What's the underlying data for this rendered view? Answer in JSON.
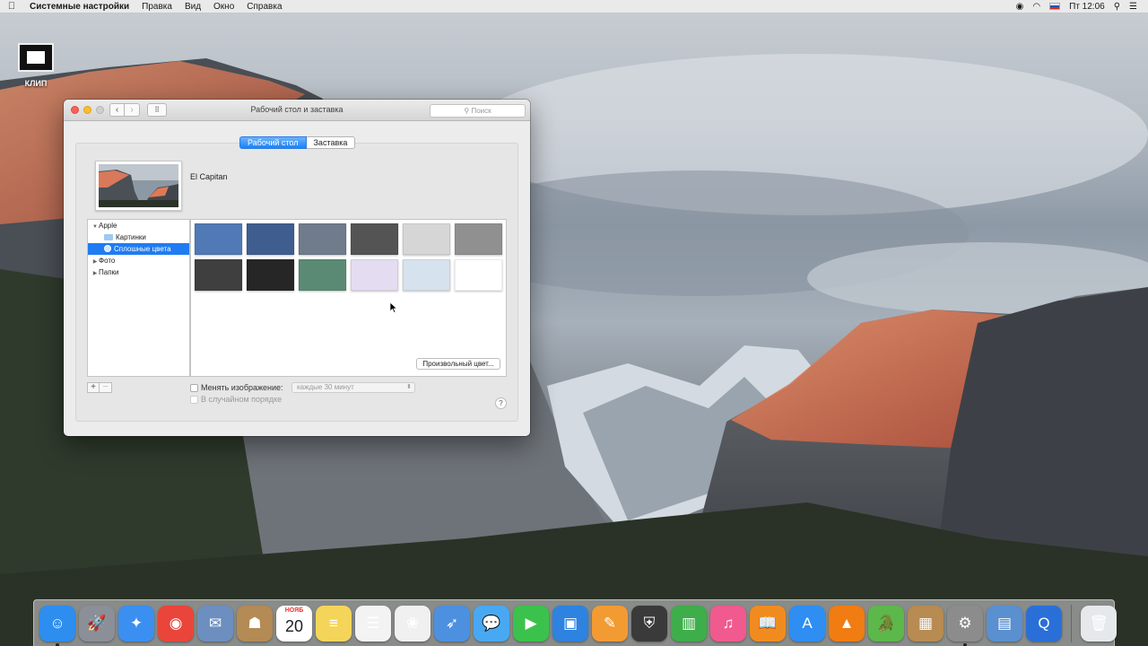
{
  "menubar": {
    "app_name": "Системные настройки",
    "menus": [
      "Правка",
      "Вид",
      "Окно",
      "Справка"
    ],
    "clock": "Пт 12:06"
  },
  "desktop_icon": {
    "label": "КЛИП"
  },
  "window": {
    "title": "Рабочий стол и заставка",
    "search_placeholder": "Поиск",
    "tabs": [
      {
        "label": "Рабочий стол",
        "selected": true
      },
      {
        "label": "Заставка",
        "selected": false
      }
    ],
    "preview_name": "El Capitan",
    "sidebar": [
      {
        "label": "Apple",
        "level": 1,
        "expanded": true
      },
      {
        "label": "Картинки",
        "level": 2,
        "icon": "folder-icon"
      },
      {
        "label": "Сплошные цвета",
        "level": 2,
        "icon": "color-dot-icon",
        "selected": true
      },
      {
        "label": "Фото",
        "level": 1,
        "expanded": false
      },
      {
        "label": "Папки",
        "level": 1,
        "expanded": false
      }
    ],
    "swatches": [
      "#5079b6",
      "#3f5e8f",
      "#707b8b",
      "#545454",
      "#d6d6d6",
      "#909090",
      "#3f3f3f",
      "#262626",
      "#5b8a74",
      "#e4dcf0",
      "#d6e2ee",
      "#ffffff"
    ],
    "custom_color_button": "Произвольный цвет...",
    "change_picture_label": "Менять изображение:",
    "interval_value": "каждые 30 минут",
    "random_order_label": "В случайном порядке",
    "help_label": "?"
  },
  "dock": [
    {
      "name": "finder",
      "icon": "finder-icon",
      "glyph": "☺",
      "color": "#2d8ef0",
      "running": true
    },
    {
      "name": "launchpad",
      "icon": "rocket-icon",
      "glyph": "🚀",
      "color": "#8a8f98",
      "running": false
    },
    {
      "name": "safari",
      "icon": "compass-icon",
      "glyph": "✦",
      "color": "#3b8ff0",
      "running": false
    },
    {
      "name": "chrome",
      "icon": "chrome-icon",
      "glyph": "◉",
      "color": "#e9453a",
      "running": false
    },
    {
      "name": "mail",
      "icon": "stamp-icon",
      "glyph": "✉",
      "color": "#6d8fbf",
      "running": false
    },
    {
      "name": "contacts",
      "icon": "contacts-icon",
      "glyph": "☗",
      "color": "#b48a55",
      "running": false
    },
    {
      "name": "calendar",
      "icon": "calendar-icon",
      "month": "НОЯБ",
      "day": "20",
      "color": "#ffffff",
      "running": false
    },
    {
      "name": "notes",
      "icon": "notes-icon",
      "glyph": "≡",
      "color": "#f4d55a",
      "running": false
    },
    {
      "name": "reminders",
      "icon": "list-icon",
      "glyph": "☰",
      "color": "#f3f3f3",
      "running": false
    },
    {
      "name": "photos",
      "icon": "flower-icon",
      "glyph": "❀",
      "color": "#f0f0f0",
      "running": false
    },
    {
      "name": "mail-app",
      "icon": "bird-icon",
      "glyph": "➶",
      "color": "#4d90e0",
      "running": false
    },
    {
      "name": "messages",
      "icon": "chat-bubble-icon",
      "glyph": "💬",
      "color": "#48a9f2",
      "running": false
    },
    {
      "name": "facetime",
      "icon": "video-camera-icon",
      "glyph": "▶",
      "color": "#3bc24c",
      "running": false
    },
    {
      "name": "keynote",
      "icon": "podium-icon",
      "glyph": "▣",
      "color": "#2e82e0",
      "running": false
    },
    {
      "name": "pages",
      "icon": "pages-icon",
      "glyph": "✎",
      "color": "#f29b32",
      "running": false
    },
    {
      "name": "world-of-tanks",
      "icon": "tank-emblem-icon",
      "glyph": "⛨",
      "color": "#3a3a3a",
      "running": false
    },
    {
      "name": "numbers",
      "icon": "bar-chart-icon",
      "glyph": "▥",
      "color": "#3dae4a",
      "running": false
    },
    {
      "name": "itunes",
      "icon": "music-note-icon",
      "glyph": "♫",
      "color": "#f05a8e",
      "running": false
    },
    {
      "name": "ibooks",
      "icon": "book-icon",
      "glyph": "📖",
      "color": "#f08c1f",
      "running": false
    },
    {
      "name": "app-store",
      "icon": "app-store-icon",
      "glyph": "A",
      "color": "#2f8ef2",
      "running": false
    },
    {
      "name": "vlc",
      "icon": "traffic-cone-icon",
      "glyph": "▲",
      "color": "#f07c12",
      "running": false
    },
    {
      "name": "crocodile-game",
      "icon": "crocodile-icon",
      "glyph": "🐊",
      "color": "#5cb84a",
      "running": false
    },
    {
      "name": "archive-utility",
      "icon": "box-icon",
      "glyph": "▦",
      "color": "#b78b52",
      "running": false
    },
    {
      "name": "system-preferences",
      "icon": "gear-icon",
      "glyph": "⚙",
      "color": "#8c8c8c",
      "running": true
    },
    {
      "name": "preview",
      "icon": "photo-viewer-icon",
      "glyph": "▤",
      "color": "#5a8fd0",
      "running": false
    },
    {
      "name": "quicktime",
      "icon": "quicktime-icon",
      "glyph": "Q",
      "color": "#2a6fd8",
      "running": false
    },
    {
      "name": "trash",
      "icon": "trash-icon",
      "glyph": "🗑",
      "color": "#e6e9ec",
      "running": false
    }
  ]
}
